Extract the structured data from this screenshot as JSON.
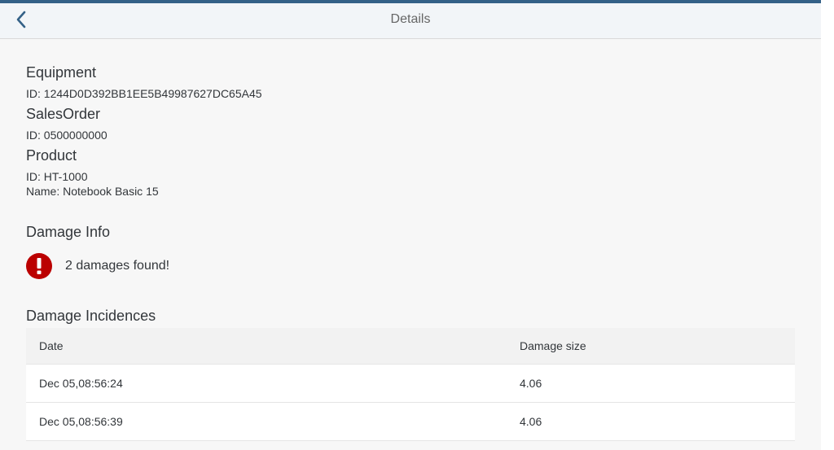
{
  "header": {
    "title": "Details",
    "accent_color": "#346187"
  },
  "equipment": {
    "title": "Equipment",
    "id_text": "ID: 1244D0D392BB1EE5B49987627DC65A45"
  },
  "sales_order": {
    "title": "SalesOrder",
    "id_text": "ID: 0500000000"
  },
  "product": {
    "title": "Product",
    "id_text": "ID: HT-1000",
    "name_text": "Name: Notebook Basic 15"
  },
  "damage_info": {
    "title": "Damage Info",
    "message": "2 damages found!",
    "icon": "error-icon",
    "icon_color": "#bb0000"
  },
  "damage_incidences": {
    "title": "Damage Incidences",
    "columns": [
      "Date",
      "Damage size"
    ],
    "rows": [
      {
        "date": "Dec 05,08:56:24",
        "size": "4.06"
      },
      {
        "date": "Dec 05,08:56:39",
        "size": "4.06"
      }
    ]
  }
}
